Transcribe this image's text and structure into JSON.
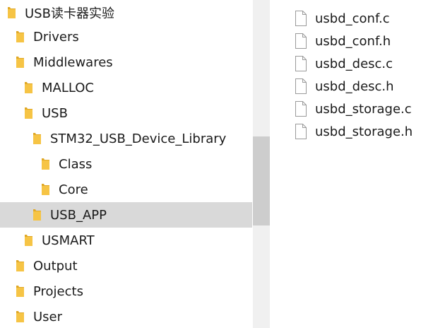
{
  "tree": {
    "items": [
      {
        "label": "USB读卡器实验"
      },
      {
        "label": "Drivers"
      },
      {
        "label": "Middlewares"
      },
      {
        "label": "MALLOC"
      },
      {
        "label": "USB"
      },
      {
        "label": "STM32_USB_Device_Library"
      },
      {
        "label": "Class"
      },
      {
        "label": "Core"
      },
      {
        "label": "USB_APP",
        "selected": true
      },
      {
        "label": "USMART"
      },
      {
        "label": "Output"
      },
      {
        "label": "Projects"
      },
      {
        "label": "User"
      }
    ]
  },
  "files": {
    "items": [
      {
        "label": "usbd_conf.c"
      },
      {
        "label": "usbd_conf.h"
      },
      {
        "label": "usbd_desc.c"
      },
      {
        "label": "usbd_desc.h"
      },
      {
        "label": "usbd_storage.c"
      },
      {
        "label": "usbd_storage.h"
      }
    ]
  },
  "colors": {
    "folder": "#f6c445",
    "folder_dark": "#e0a826",
    "selection": "#d9d9d9",
    "scroll_thumb": "#cdcdcd"
  }
}
